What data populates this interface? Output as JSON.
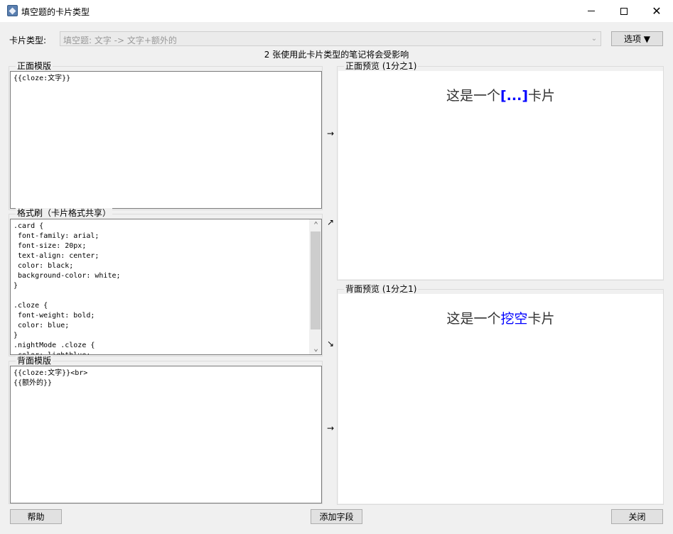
{
  "window": {
    "title": "填空题的卡片类型",
    "icon": "anki-app-icon"
  },
  "top": {
    "card_type_label": "卡片类型:",
    "card_type_value": "填空题: 文字 -> 文字+额外的",
    "options_button": "选项 ▼",
    "notice": "2 张使用此卡片类型的笔记将会受影响"
  },
  "front_template": {
    "title": "正面模版",
    "content": "{{cloze:文字}}"
  },
  "styling": {
    "title": "格式刷（卡片格式共享）",
    "lines": [
      ".card {",
      " font-family: arial;",
      " font-size: 20px;",
      " text-align: center;",
      " color: black;",
      " background-color: white;",
      "}",
      "",
      ".cloze {",
      " font-weight: bold;",
      " color: blue;",
      "}",
      ".nightMode .cloze {",
      " color: lightblue;"
    ]
  },
  "back_template": {
    "title": "背面模版",
    "content": "{{cloze:文字}}<br>\n{{额外的}}"
  },
  "front_preview": {
    "title": "正面预览 (1分之1)",
    "text_before": "这是一个",
    "cloze": "[...]",
    "text_after": "卡片"
  },
  "back_preview": {
    "title": "背面预览 (1分之1)",
    "text_before": "这是一个",
    "cloze": "挖空",
    "text_after": "卡片"
  },
  "arrows": {
    "front": "→",
    "styling_up": "↗",
    "styling_down": "↘",
    "back": "→"
  },
  "bottom": {
    "help_button": "帮助",
    "add_field_button": "添加字段",
    "close_button": "关闭"
  },
  "colors": {
    "cloze": "#0000ff",
    "window_bg": "#f0f0f0"
  }
}
